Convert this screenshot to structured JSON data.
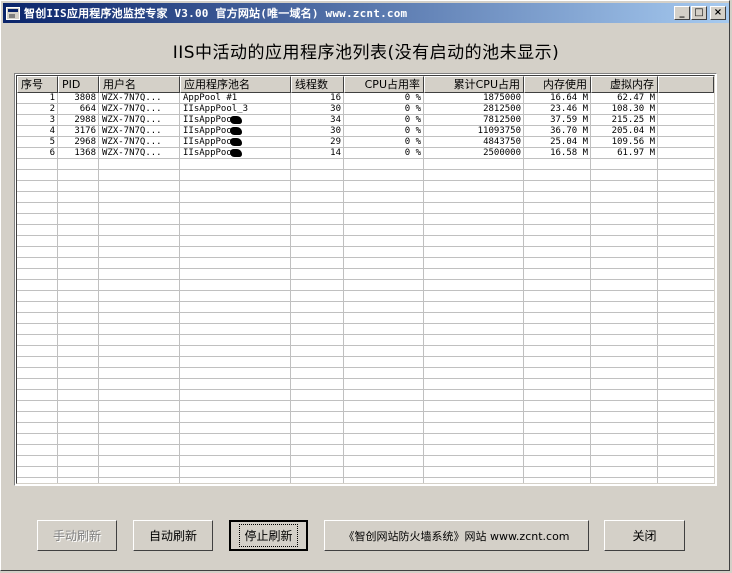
{
  "window": {
    "title": "智创IIS应用程序池监控专家 V3.00 官方网站(唯一域名) www.zcnt.com",
    "min_glyph": "_",
    "max_glyph": "□",
    "close_glyph": "×"
  },
  "list": {
    "title": "IIS中活动的应用程序池列表(没有启动的池未显示)",
    "columns": [
      "序号",
      "PID",
      "用户名",
      "应用程序池名",
      "线程数",
      "CPU占用率",
      "累计CPU占用",
      "内存使用",
      "虚拟内存"
    ],
    "rows": [
      [
        "1",
        "3808",
        "WZX-7N7Q...",
        "AppPool #1",
        "16",
        "0 %",
        "1875000",
        "16.64 M",
        "62.47 M"
      ],
      [
        "2",
        "664",
        "WZX-7N7Q...",
        "IIsAppPool_3",
        "30",
        "0 %",
        "2812500",
        "23.46 M",
        "108.30 M"
      ],
      [
        "3",
        "2988",
        "WZX-7N7Q...",
        "IIsAppPoo",
        "34",
        "0 %",
        "7812500",
        "37.59 M",
        "215.25 M"
      ],
      [
        "4",
        "3176",
        "WZX-7N7Q...",
        "IIsAppPoo",
        "30",
        "0 %",
        "11093750",
        "36.70 M",
        "205.04 M"
      ],
      [
        "5",
        "2968",
        "WZX-7N7Q...",
        "IIsAppPoo",
        "29",
        "0 %",
        "4843750",
        "25.04 M",
        "109.56 M"
      ],
      [
        "6",
        "1368",
        "WZX-7N7Q...",
        "IIsAppPoo",
        "14",
        "0 %",
        "2500000",
        "16.58 M",
        "61.97 M"
      ]
    ],
    "redacted_rows": [
      2,
      3,
      4,
      5
    ]
  },
  "buttons": {
    "manual_refresh": "手动刷新",
    "auto_refresh": "自动刷新",
    "stop_refresh": "停止刷新",
    "website": "《智创网站防火墙系统》网站  www.zcnt.com",
    "close": "关闭"
  }
}
